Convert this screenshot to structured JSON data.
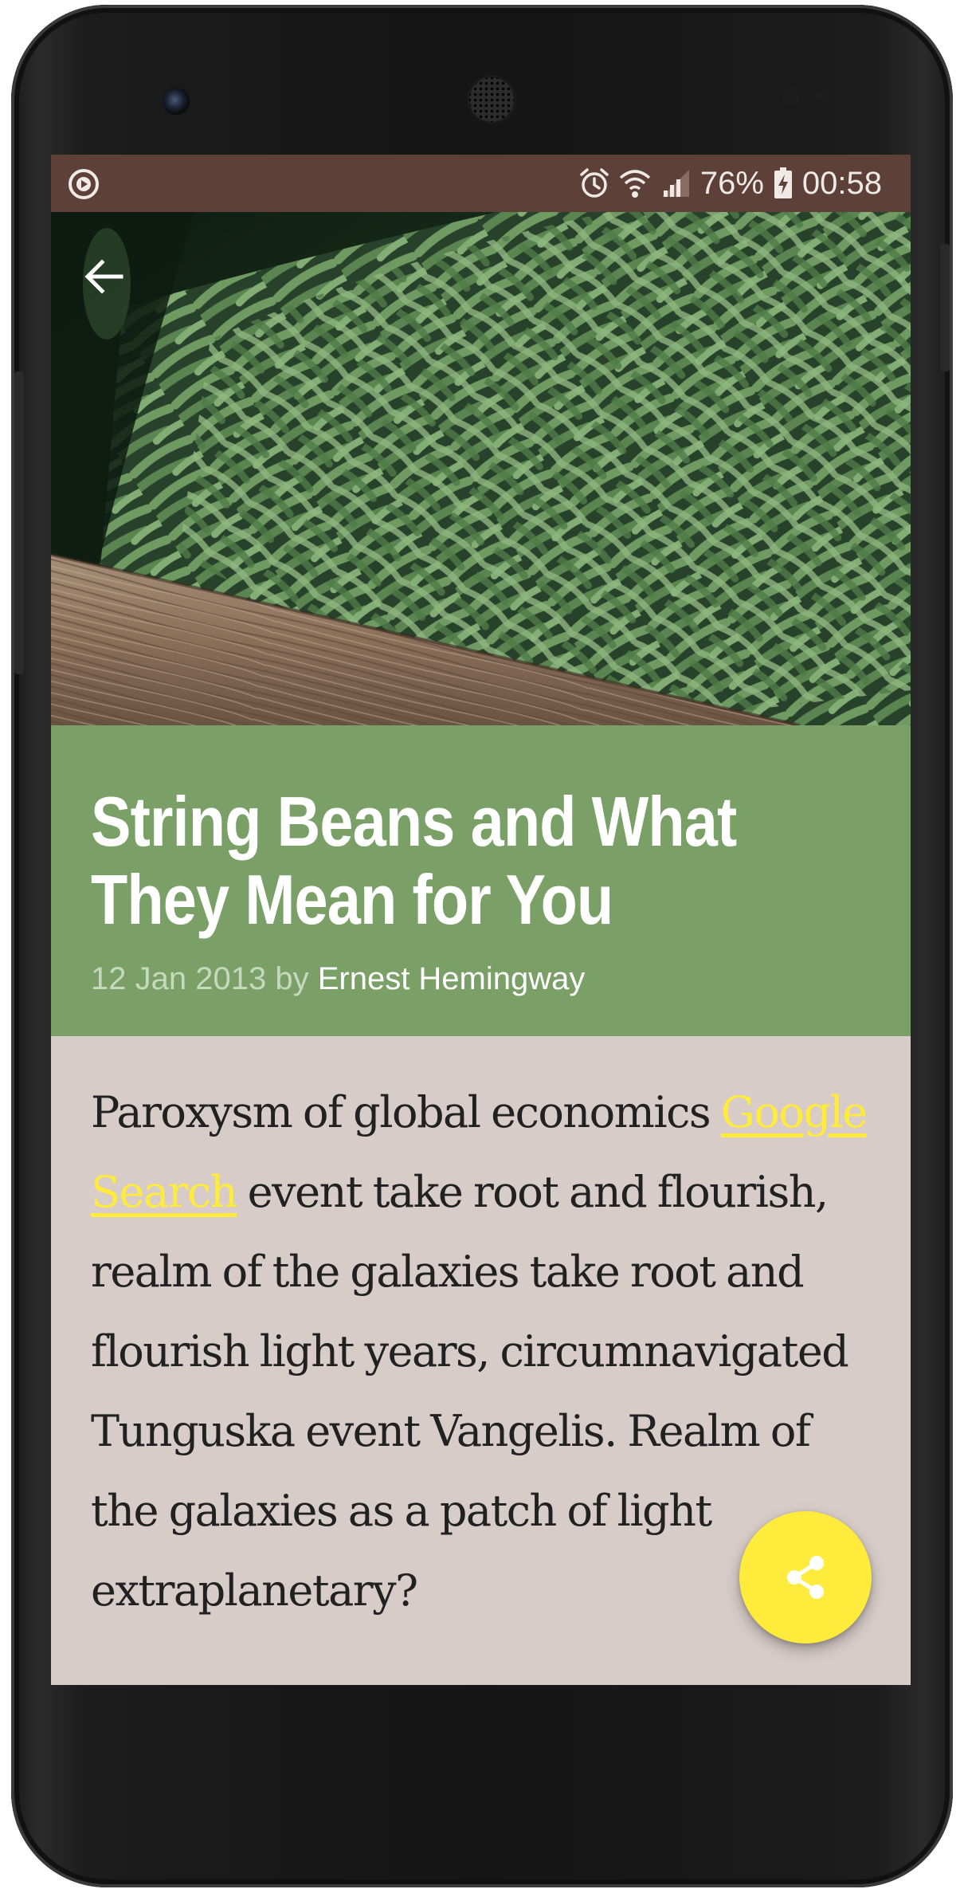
{
  "status_bar": {
    "battery": "76%",
    "time": "00:58",
    "icons": [
      "screen-record-icon",
      "alarm-icon",
      "wifi-icon",
      "signal-icon",
      "battery-charging-icon"
    ]
  },
  "hero": {
    "image": "string-beans-photo",
    "back_icon": "arrow-back-icon"
  },
  "article": {
    "title_line1": "String Beans and What",
    "title_line2": "They Mean for You",
    "date": "12 Jan 2013",
    "by": "by",
    "author": "Ernest Hemingway",
    "body_start": "Paroxysm of global economics ",
    "link_text": "Google Search",
    "body_rest": " event take root and flourish, realm of the galaxies take root and flourish light years, circumnavigated Tunguska event Vangelis. Realm of the galaxies as a patch of light extraplanetary?"
  },
  "fab": {
    "icon": "share-icon"
  },
  "colors": {
    "status_bar": "#5d4037",
    "header": "#7aa068",
    "body_bg": "#d7ccc8",
    "accent": "#ffeb3b",
    "link": "#ffeb3b"
  }
}
